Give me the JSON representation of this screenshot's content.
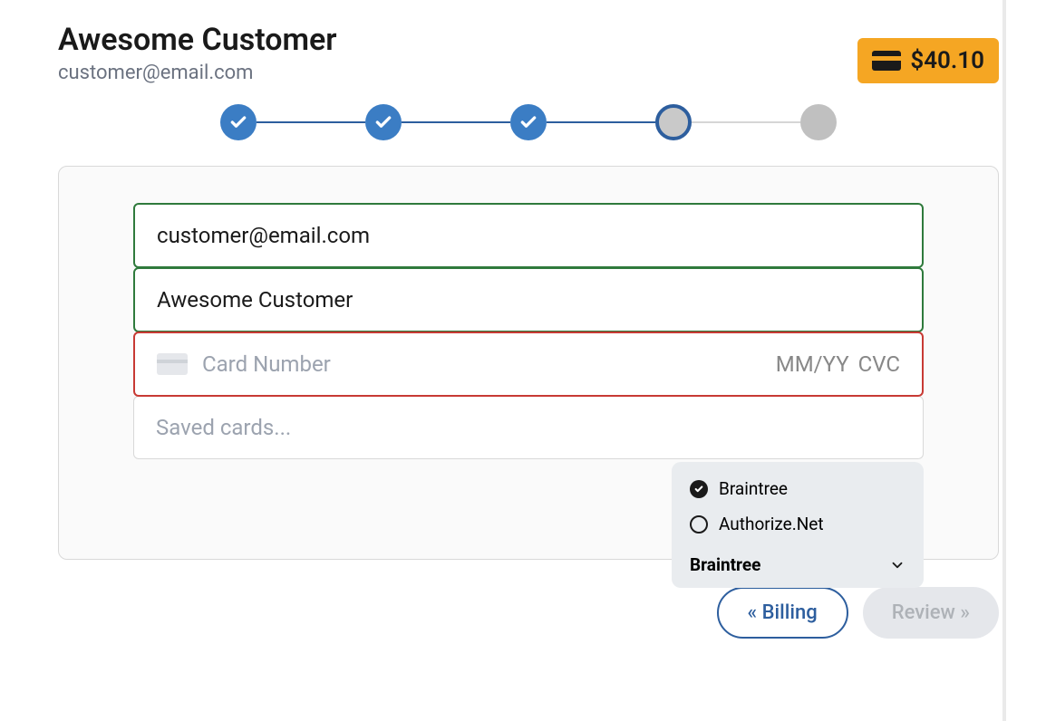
{
  "header": {
    "customer_name": "Awesome Customer",
    "customer_email": "customer@email.com",
    "price": "$40.10"
  },
  "stepper": {
    "steps": [
      "complete",
      "complete",
      "complete",
      "current",
      "future"
    ]
  },
  "form": {
    "email_value": "customer@email.com",
    "name_value": "Awesome Customer",
    "card_placeholder": "Card Number",
    "expiry_placeholder": "MM/YY",
    "cvc_placeholder": "CVC",
    "saved_cards_placeholder": "Saved cards..."
  },
  "gateway_dropdown": {
    "options": [
      {
        "label": "Braintree",
        "checked": true
      },
      {
        "label": "Authorize.Net",
        "checked": false
      }
    ],
    "selected": "Braintree"
  },
  "nav": {
    "back_label": "« Billing",
    "next_label": "Review »"
  }
}
